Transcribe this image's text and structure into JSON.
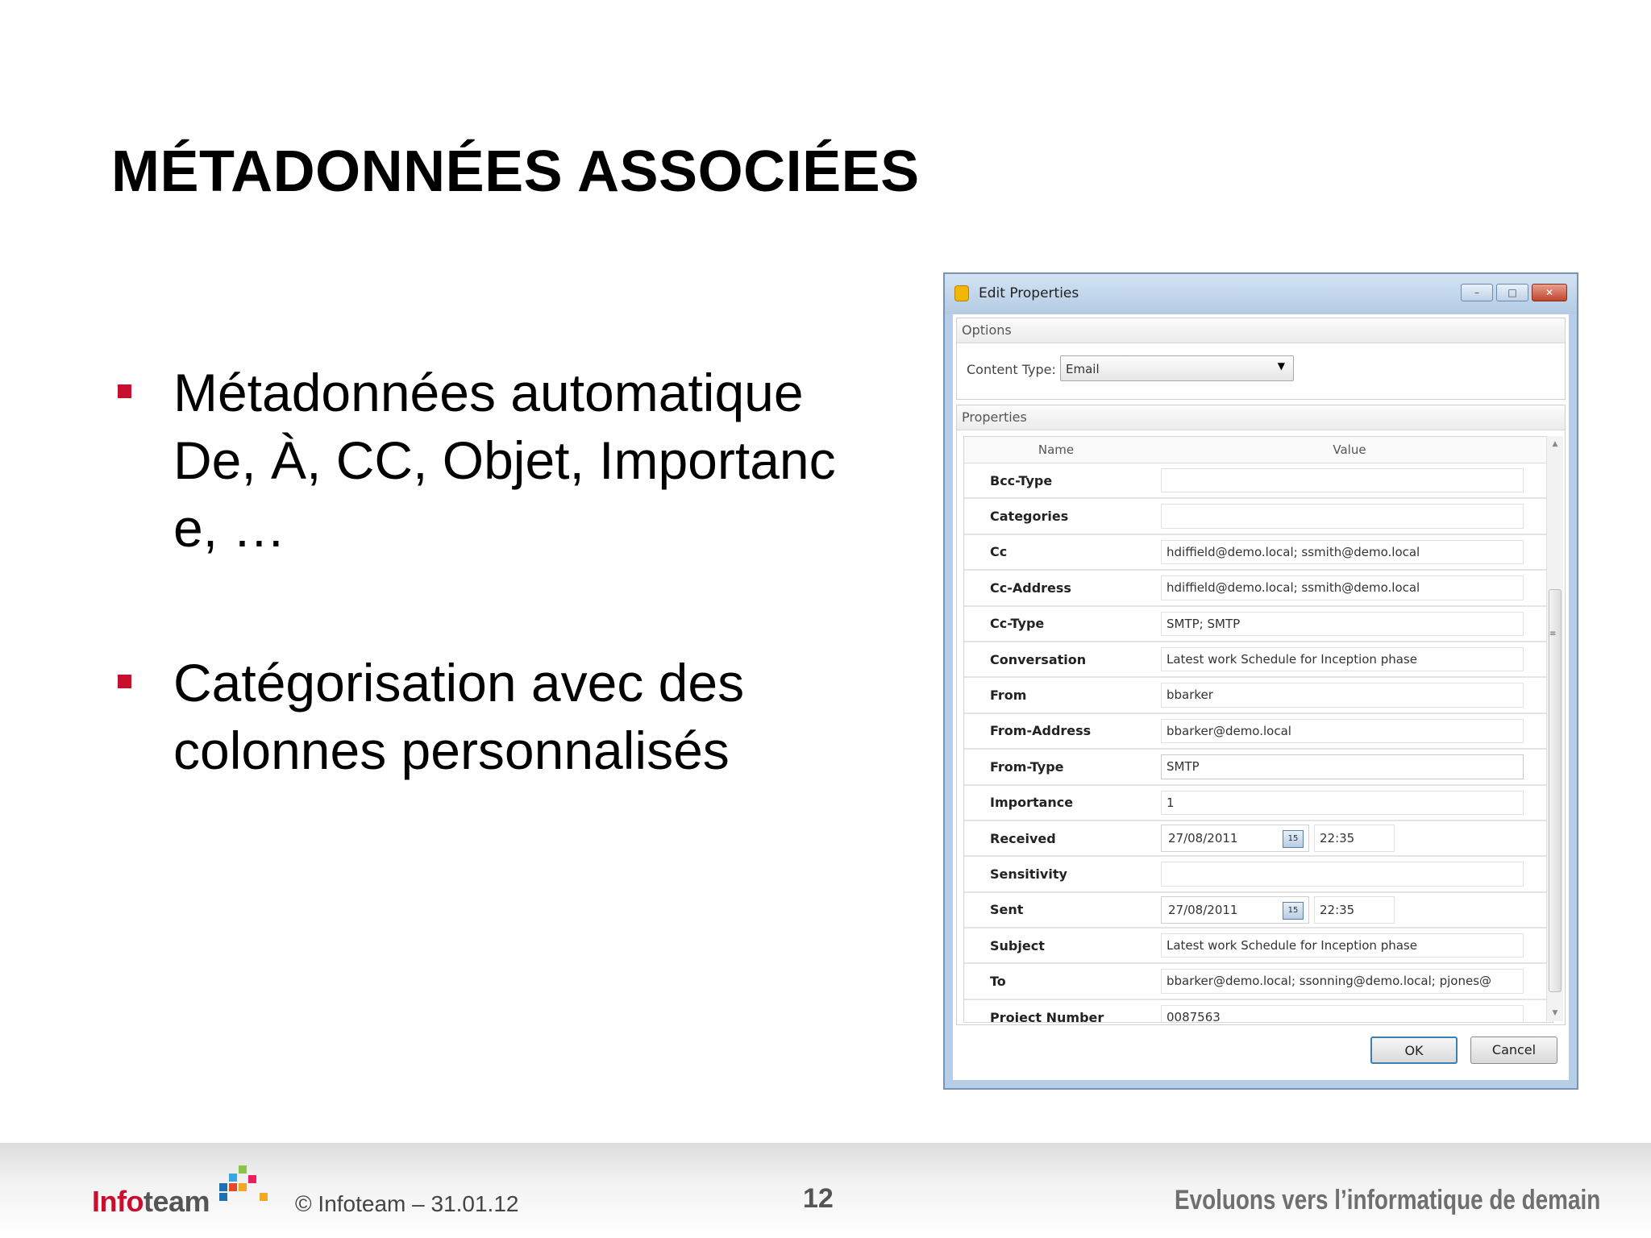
{
  "slide": {
    "title": "MÉTADONNÉES ASSOCIÉES",
    "bullets": [
      {
        "lines": [
          "Métadonnées automatique",
          "De, À, CC, Objet, Importanc",
          "e, …"
        ]
      },
      {
        "lines": [
          "Catégorisation avec des",
          "colonnes personnalisés"
        ]
      }
    ]
  },
  "dialog": {
    "title": "Edit Properties",
    "window_buttons": [
      "minimize",
      "maximize",
      "close"
    ],
    "options": {
      "header": "Options",
      "content_type_label": "Content Type:",
      "content_type_value": "Email"
    },
    "properties": {
      "header": "Properties",
      "columns": [
        "Name",
        "Value"
      ],
      "rows": [
        {
          "name": "Bcc-Type",
          "value": ""
        },
        {
          "name": "Categories",
          "value": ""
        },
        {
          "name": "Cc",
          "value": "hdiffield@demo.local; ssmith@demo.local"
        },
        {
          "name": "Cc-Address",
          "value": "hdiffield@demo.local; ssmith@demo.local"
        },
        {
          "name": "Cc-Type",
          "value": "SMTP; SMTP"
        },
        {
          "name": "Conversation",
          "value": "Latest work Schedule for Inception phase"
        },
        {
          "name": "From",
          "value": "bbarker"
        },
        {
          "name": "From-Address",
          "value": "bbarker@demo.local"
        },
        {
          "name": "From-Type",
          "value": "SMTP"
        },
        {
          "name": "Importance",
          "value": "1"
        },
        {
          "name": "Received",
          "date": "27/08/2011",
          "time": "22:35"
        },
        {
          "name": "Sensitivity",
          "value": ""
        },
        {
          "name": "Sent",
          "date": "27/08/2011",
          "time": "22:35"
        },
        {
          "name": "Subject",
          "value": "Latest work Schedule for Inception phase"
        },
        {
          "name": "To",
          "value": "bbarker@demo.local; ssonning@demo.local; pjones@"
        },
        {
          "name": "Project Number",
          "value": "0087563"
        }
      ]
    },
    "buttons": {
      "ok": "OK",
      "cancel": "Cancel"
    }
  },
  "footer": {
    "brand_info": "Info",
    "brand_team": "team",
    "copyright": "© Infoteam – 31.01.12",
    "page_number": "12",
    "tagline": "Evoluons vers l’informatique de demain"
  },
  "colors": {
    "accent_red": "#c8102e",
    "dialog_frame": "#b7cee6"
  },
  "icons": [
    "app-icon",
    "calendar-icon",
    "dropdown-arrow-icon",
    "infoteam-logo-pixels"
  ]
}
